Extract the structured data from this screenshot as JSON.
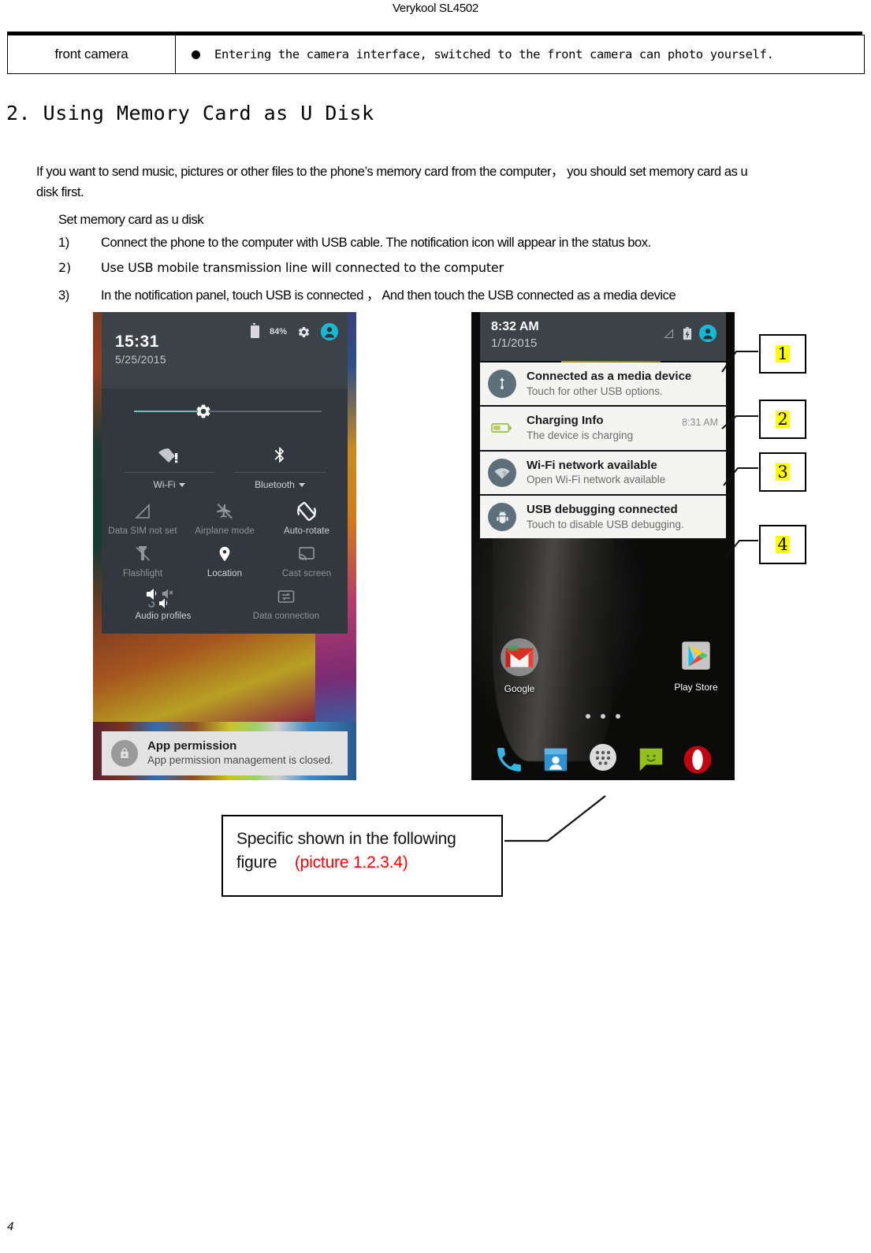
{
  "document": {
    "running_header": "Verykool SL4502",
    "page_number": "4"
  },
  "feature_table": {
    "rows": [
      {
        "label": "front camera",
        "bullet": "●",
        "description": "Entering the camera interface, switched to the front camera can photo yourself."
      }
    ]
  },
  "section": {
    "heading": "2. Using Memory Card as U Disk",
    "intro_line1": "If you want to send music, pictures or other files to the phone’s memory card from the computer， you should set memory card as u",
    "intro_line2": "disk first.",
    "subheading": "Set memory card as u disk",
    "steps": [
      {
        "index": "1)",
        "text": "Connect the phone to the computer with USB cable. The notification icon will appear in the status box."
      },
      {
        "index": "2)",
        "text": "Use USB mobile transmission line will connected to the computer"
      },
      {
        "index": "3)",
        "text": "In the notification panel, touch USB is connected  ， And then touch the USB connected as a media device"
      }
    ]
  },
  "screenshot_left": {
    "status": {
      "battery_percent": "84%",
      "battery_icon": "battery-icon",
      "settings_icon": "gear-icon",
      "user_icon": "user-avatar-icon"
    },
    "clock": "15:31",
    "date": "5/25/2015",
    "brightness_slider": {
      "icon": "brightness-knob-icon",
      "fill_percent": 30
    },
    "toggles_top": [
      {
        "label": "Wi-Fi",
        "icon": "wifi-alert-icon",
        "has_caret": true
      },
      {
        "label": "Bluetooth",
        "icon": "bluetooth-icon",
        "has_caret": true
      }
    ],
    "tiles": [
      {
        "label": "Data SIM not set",
        "icon": "signal-off-icon",
        "dim": true
      },
      {
        "label": "Airplane mode",
        "icon": "airplane-off-icon",
        "dim": true
      },
      {
        "label": "Auto-rotate",
        "icon": "auto-rotate-icon",
        "dim": false
      },
      {
        "label": "Flashlight",
        "icon": "flashlight-off-icon",
        "dim": true
      },
      {
        "label": "Location",
        "icon": "location-pin-icon",
        "dim": false
      },
      {
        "label": "Cast screen",
        "icon": "cast-screen-icon",
        "dim": true
      },
      {
        "label": "Audio profiles",
        "icon": "audio-profiles-icon",
        "dim": false
      },
      {
        "label": "Data connection",
        "icon": "data-connection-icon",
        "dim": true
      }
    ],
    "notification": {
      "icon": "lock-icon",
      "title": "App permission",
      "subtitle": "App permission management is closed."
    }
  },
  "screenshot_right": {
    "status": {
      "time": "8:32 AM",
      "date": "1/1/2015",
      "signal_icon": "signal-triangle-icon",
      "battery_icon": "battery-charging-icon",
      "user_icon": "user-avatar-icon"
    },
    "notifications": [
      {
        "icon": "usb-icon",
        "title": "Connected as a media device",
        "subtitle": "Touch for other USB options.",
        "timestamp": ""
      },
      {
        "icon": "battery-charging-icon",
        "title": "Charging Info",
        "subtitle": "The device is charging",
        "timestamp": "8:31 AM"
      },
      {
        "icon": "wifi-question-icon",
        "title": "Wi-Fi network available",
        "subtitle": "Open Wi-Fi network available",
        "timestamp": ""
      },
      {
        "icon": "android-debug-icon",
        "title": "USB debugging connected",
        "subtitle": "Touch to disable USB debugging.",
        "timestamp": ""
      }
    ],
    "home_screen": {
      "apps": [
        {
          "label": "Google",
          "icon": "gmail-icon"
        },
        {
          "label": "Play Store",
          "icon": "play-store-icon"
        }
      ],
      "page_dots": 3,
      "dock": [
        {
          "icon": "phone-icon"
        },
        {
          "icon": "contacts-icon"
        },
        {
          "icon": "app-drawer-icon"
        },
        {
          "icon": "messaging-icon"
        },
        {
          "icon": "opera-icon"
        }
      ]
    }
  },
  "callouts": [
    {
      "number": "1"
    },
    {
      "number": "2"
    },
    {
      "number": "3"
    },
    {
      "number": "4"
    }
  ],
  "caption": {
    "line1": "Specific shown in the following",
    "line2_black": "figure",
    "line2_red": "(picture 1.2.3.4)"
  },
  "colors": {
    "highlight": "#ffff00",
    "red_text": "#ff0000",
    "android_accent": "#18b8d4",
    "panel_bg": "#32383e"
  }
}
